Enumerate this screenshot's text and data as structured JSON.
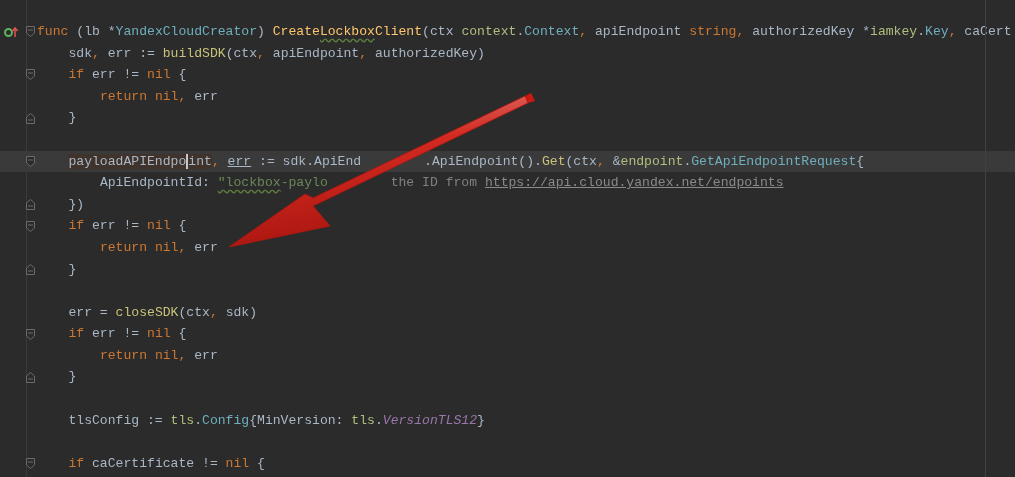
{
  "lines": [
    {
      "current": false,
      "kind": "foldstart",
      "parts": [
        [
          {
            "kind": "keyword",
            "text": "func "
          },
          {
            "kind": "plain",
            "text": "(lb *"
          },
          {
            "kind": "type",
            "text": "YandexCloudCreator"
          },
          {
            "kind": "plain",
            "text": ") "
          },
          {
            "kind": "function",
            "text": "Create"
          },
          {
            "kind": "typo",
            "text": "Lockbox"
          },
          {
            "kind": "function",
            "text": "Client"
          },
          {
            "kind": "plain",
            "text": "(ctx "
          },
          {
            "kind": "package",
            "text": "context"
          },
          {
            "kind": "plain",
            "text": "."
          },
          {
            "kind": "type",
            "text": "Context"
          },
          {
            "kind": "punct",
            "text": ", "
          },
          {
            "kind": "plain",
            "text": "apiEndpoint "
          },
          {
            "kind": "keyword",
            "text": "string"
          },
          {
            "kind": "punct",
            "text": ", "
          },
          {
            "kind": "plain",
            "text": "authorizedKey *"
          },
          {
            "kind": "package",
            "text": "iamkey"
          },
          {
            "kind": "plain",
            "text": "."
          },
          {
            "kind": "type",
            "text": "Key"
          },
          {
            "kind": "punct",
            "text": ", "
          },
          {
            "kind": "plain",
            "text": "caCert"
          }
        ]
      ]
    },
    {
      "current": false,
      "kind": "plain",
      "parts": [
        [
          {
            "kind": "plain",
            "text": "    sdk"
          },
          {
            "kind": "punct",
            "text": ", "
          },
          {
            "kind": "plain",
            "text": "err := "
          },
          {
            "kind": "call",
            "text": "buildSDK"
          },
          {
            "kind": "plain",
            "text": "(ctx"
          },
          {
            "kind": "punct",
            "text": ", "
          },
          {
            "kind": "plain",
            "text": "apiEndpoint"
          },
          {
            "kind": "punct",
            "text": ", "
          },
          {
            "kind": "plain",
            "text": "authorizedKey)"
          }
        ]
      ]
    },
    {
      "current": false,
      "kind": "foldstart",
      "parts": [
        [
          {
            "kind": "keyword",
            "text": "    if "
          },
          {
            "kind": "plain",
            "text": "err != "
          },
          {
            "kind": "keyword",
            "text": "nil "
          },
          {
            "kind": "plain",
            "text": "{"
          }
        ]
      ]
    },
    {
      "current": false,
      "kind": "plain",
      "parts": [
        [
          {
            "kind": "keyword",
            "text": "        return nil"
          },
          {
            "kind": "punct",
            "text": ", "
          },
          {
            "kind": "plain",
            "text": "err"
          }
        ]
      ]
    },
    {
      "current": false,
      "kind": "foldend",
      "parts": [
        [
          {
            "kind": "plain",
            "text": "    }"
          }
        ]
      ]
    },
    {
      "current": false,
      "kind": "plain"
    },
    {
      "current": true,
      "kind": "foldstart",
      "parts": [
        [
          {
            "kind": "usage",
            "text": "    payloadAPIEndpo",
            "caret": true
          },
          {
            "kind": "usage",
            "text": "int"
          },
          {
            "kind": "punct",
            "text": ", "
          },
          {
            "kind": "reassigned",
            "text": "err"
          },
          {
            "kind": "plain",
            "text": " := sdk.ApiEnd"
          }
        ],
        [
          {
            "kind": "plain",
            "text": ".ApiEndpoint()."
          },
          {
            "kind": "call",
            "text": "Get"
          },
          {
            "kind": "plain",
            "text": "(ctx"
          },
          {
            "kind": "punct",
            "text": ", "
          },
          {
            "kind": "plain",
            "text": "&"
          },
          {
            "kind": "package",
            "text": "endpoint"
          },
          {
            "kind": "plain",
            "text": "."
          },
          {
            "kind": "type",
            "text": "GetApiEndpointRequest"
          },
          {
            "kind": "plain",
            "text": "{"
          }
        ]
      ]
    },
    {
      "current": false,
      "kind": "plain",
      "parts": [
        [
          {
            "kind": "plain",
            "text": "        ApiEndpointId: "
          },
          {
            "kind": "typostring",
            "text": "\"lockbox"
          },
          {
            "kind": "string",
            "text": "-paylo"
          }
        ],
        [
          {
            "kind": "comment",
            "text": "the ID from "
          },
          {
            "kind": "link",
            "text": "https://api.cloud.yandex.net/endpoints"
          }
        ]
      ]
    },
    {
      "current": false,
      "kind": "foldend",
      "parts": [
        [
          {
            "kind": "plain",
            "text": "    })"
          }
        ]
      ]
    },
    {
      "current": false,
      "kind": "foldstart",
      "parts": [
        [
          {
            "kind": "keyword",
            "text": "    if "
          },
          {
            "kind": "plain",
            "text": "err != "
          },
          {
            "kind": "keyword",
            "text": "nil "
          },
          {
            "kind": "plain",
            "text": "{"
          }
        ]
      ]
    },
    {
      "current": false,
      "kind": "plain",
      "parts": [
        [
          {
            "kind": "keyword",
            "text": "        return nil"
          },
          {
            "kind": "punct",
            "text": ", "
          },
          {
            "kind": "plain",
            "text": "err"
          }
        ]
      ]
    },
    {
      "current": false,
      "kind": "foldend",
      "parts": [
        [
          {
            "kind": "plain",
            "text": "    }"
          }
        ]
      ]
    },
    {
      "current": false,
      "kind": "plain"
    },
    {
      "current": false,
      "kind": "plain",
      "parts": [
        [
          {
            "kind": "plain",
            "text": "    err = "
          },
          {
            "kind": "call",
            "text": "closeSDK"
          },
          {
            "kind": "plain",
            "text": "(ctx"
          },
          {
            "kind": "punct",
            "text": ", "
          },
          {
            "kind": "plain",
            "text": "sdk)"
          }
        ]
      ]
    },
    {
      "current": false,
      "kind": "foldstart",
      "parts": [
        [
          {
            "kind": "keyword",
            "text": "    if "
          },
          {
            "kind": "plain",
            "text": "err != "
          },
          {
            "kind": "keyword",
            "text": "nil "
          },
          {
            "kind": "plain",
            "text": "{"
          }
        ]
      ]
    },
    {
      "current": false,
      "kind": "plain",
      "parts": [
        [
          {
            "kind": "keyword",
            "text": "        return nil"
          },
          {
            "kind": "punct",
            "text": ", "
          },
          {
            "kind": "plain",
            "text": "err"
          }
        ]
      ]
    },
    {
      "current": false,
      "kind": "foldend",
      "parts": [
        [
          {
            "kind": "plain",
            "text": "    }"
          }
        ]
      ]
    },
    {
      "current": false,
      "kind": "plain"
    },
    {
      "current": false,
      "kind": "plain",
      "parts": [
        [
          {
            "kind": "plain",
            "text": "    tlsConfig := "
          },
          {
            "kind": "package",
            "text": "tls"
          },
          {
            "kind": "plain",
            "text": "."
          },
          {
            "kind": "type",
            "text": "Config"
          },
          {
            "kind": "plain",
            "text": "{MinVersion: "
          },
          {
            "kind": "package",
            "text": "tls"
          },
          {
            "kind": "plain",
            "text": "."
          },
          {
            "kind": "constant",
            "text": "VersionTLS12"
          },
          {
            "kind": "plain",
            "text": "}"
          }
        ]
      ]
    },
    {
      "current": false,
      "kind": "plain"
    },
    {
      "current": false,
      "kind": "foldstart",
      "parts": [
        [
          {
            "kind": "keyword",
            "text": "    if "
          },
          {
            "kind": "plain",
            "text": "caCertificate != "
          },
          {
            "kind": "keyword",
            "text": "nil "
          },
          {
            "kind": "plain",
            "text": "{"
          }
        ]
      ]
    }
  ]
}
